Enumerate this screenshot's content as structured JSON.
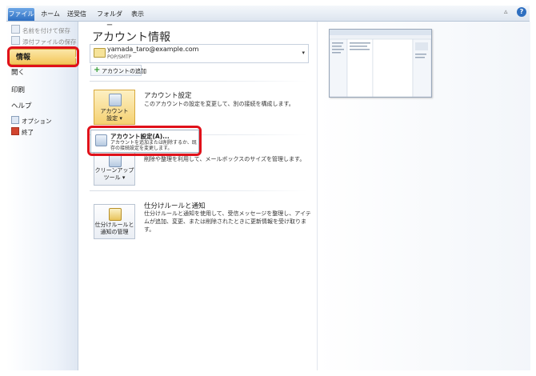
{
  "ribbon": {
    "tabs": [
      "ファイル",
      "ホーム",
      "送受信",
      "フォルダー",
      "表示"
    ]
  },
  "nav": {
    "small_items": [
      "名前を付けて保存",
      "添付ファイルの保存"
    ],
    "items": [
      "情報",
      "開く",
      "印刷",
      "ヘルプ"
    ],
    "options": [
      "オプション",
      "終了"
    ]
  },
  "main": {
    "title": "アカウント情報",
    "account": {
      "email": "yamada_taro@example.com",
      "type": "POP/SMTP"
    },
    "add_account": "アカウントの追加",
    "sections": [
      {
        "button": [
          "アカウント",
          "設定 ▾"
        ],
        "title": "アカウント設定",
        "desc": "このアカウントの設定を変更して、別の接続を構成します。"
      },
      {
        "button": [
          "クリーンアップ",
          "ツール ▾"
        ],
        "title": "",
        "desc": "削除や整理を利用して、メールボックスのサイズを管理します。"
      },
      {
        "button": [
          "仕分けルールと",
          "通知の管理"
        ],
        "title": "仕分けルールと通知",
        "desc": "仕分けルールと通知を使用して、受信メッセージを整理し、アイテムが追加、変更、または削除されたときに更新情報を受け取ります。"
      }
    ],
    "dropdown": {
      "title": "アカウント設定(A)...",
      "desc": "アカウントを追加または削除するか、既存の接続設定を変更します。"
    }
  },
  "colors": {
    "file_tab": "#2e6fc2",
    "highlight": "#e0111a",
    "selected_nav": "#f3c65a"
  }
}
